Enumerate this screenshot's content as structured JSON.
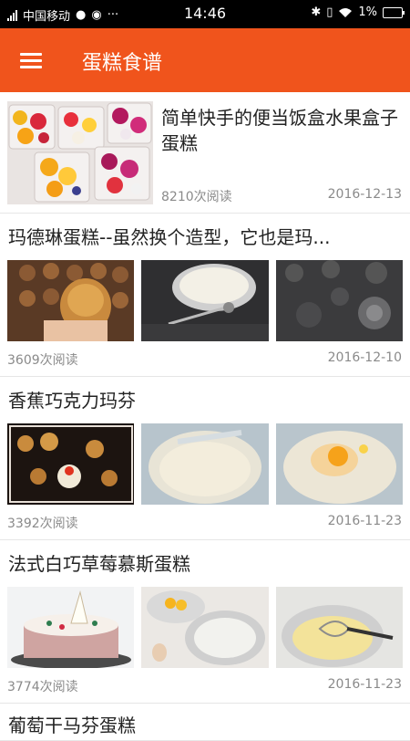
{
  "status_bar": {
    "carrier": "中国移动",
    "time": "14:46",
    "battery": "1%"
  },
  "app_bar": {
    "title": "蛋糕食谱",
    "menu_icon": "menu-icon"
  },
  "articles": [
    {
      "title": "简单快手的便当饭盒水果盒子蛋糕",
      "reads": "8210次阅读",
      "date": "2016-12-13",
      "images": [
        "fruit-box-cake"
      ]
    },
    {
      "title": "玛德琳蛋糕--虽然换个造型，它也是玛...",
      "reads": "3609次阅读",
      "date": "2016-12-10",
      "images": [
        "madeleine-molds",
        "melted-butter-bowl",
        "flower-mold"
      ]
    },
    {
      "title": "香蕉巧克力玛芬",
      "reads": "3392次阅读",
      "date": "2016-11-23",
      "images": [
        "muffins",
        "creamed-butter",
        "egg-in-batter"
      ]
    },
    {
      "title": "法式白巧草莓慕斯蛋糕",
      "reads": "3774次阅读",
      "date": "2016-11-23",
      "images": [
        "mousse-cake",
        "egg-yolks-bowls",
        "whisk-custard"
      ]
    },
    {
      "title": "葡萄干马芬蛋糕"
    }
  ]
}
